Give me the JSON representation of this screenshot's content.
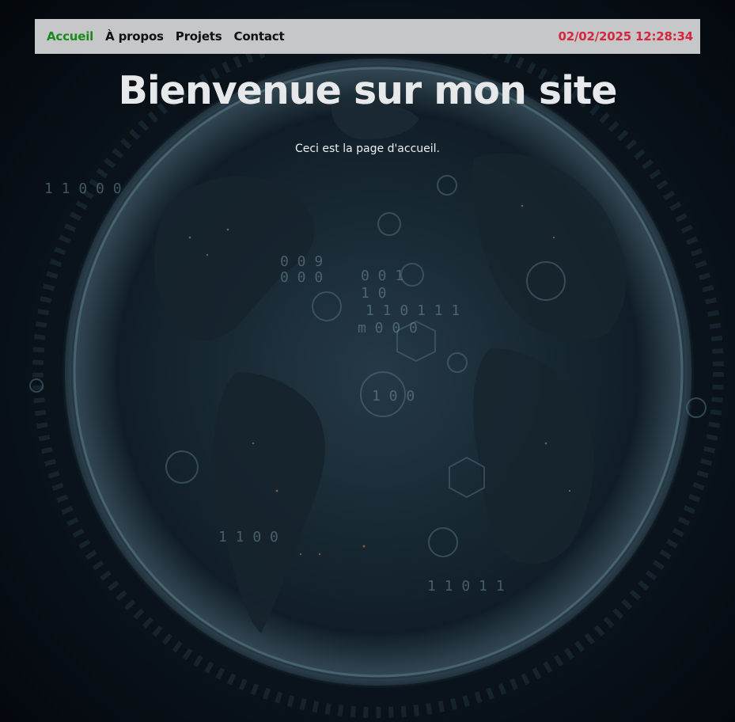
{
  "nav": {
    "items": [
      {
        "label": "Accueil",
        "active": true
      },
      {
        "label": "À propos",
        "active": false
      },
      {
        "label": "Projets",
        "active": false
      },
      {
        "label": "Contact",
        "active": false
      }
    ],
    "datetime": "02/02/2025 12:28:34"
  },
  "main": {
    "title": "Bienvenue sur mon site",
    "subtitle": "Ceci est la page d'accueil."
  },
  "colors": {
    "nav_background": "#c6c7c8",
    "active_link": "#1a8a1a",
    "datetime": "#d6263f",
    "page_background": "#03070c"
  },
  "background_image": "earth-globe-digital-network"
}
